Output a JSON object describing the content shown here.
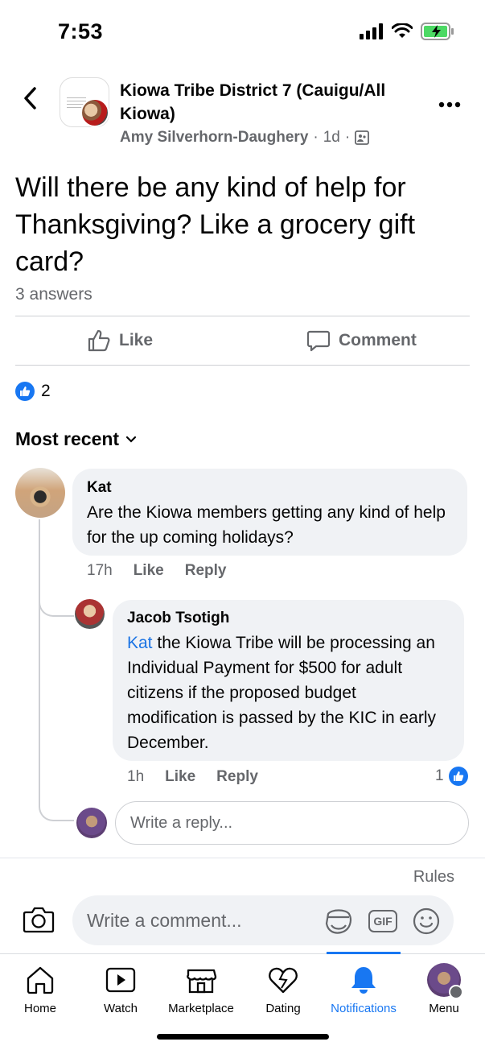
{
  "status_bar": {
    "time": "7:53"
  },
  "header": {
    "group_name": "Kiowa Tribe District 7 (Cauigu/All Kiowa)",
    "author": "Amy Silverhorn-Daughery",
    "time_ago": "1d",
    "dot": "·"
  },
  "post": {
    "question": "Will there be any kind of help for Thanksgiving? Like a grocery gift card?",
    "answers_count": "3 answers",
    "like_label": "Like",
    "comment_label": "Comment",
    "reaction_count": "2"
  },
  "sort": {
    "label": "Most recent"
  },
  "comments": [
    {
      "author": "Kat",
      "text": "Are the Kiowa members getting any kind of help for the up coming holidays?",
      "time": "17h",
      "like": "Like",
      "reply": "Reply"
    }
  ],
  "reply": {
    "author": "Jacob Tsotigh",
    "mention": "Kat",
    "text": " the Kiowa Tribe will be processing an Individual Payment for $500 for adult citizens if the proposed budget modification is passed by the KIC in early December.",
    "time": "1h",
    "like": "Like",
    "reply": "Reply",
    "reaction_count": "1"
  },
  "reply_input": {
    "placeholder": "Write a reply..."
  },
  "rules": "Rules",
  "comment_input": {
    "placeholder": "Write a comment...",
    "gif": "GIF"
  },
  "nav": [
    {
      "label": "Home",
      "icon": "home-icon"
    },
    {
      "label": "Watch",
      "icon": "watch-icon"
    },
    {
      "label": "Marketplace",
      "icon": "marketplace-icon"
    },
    {
      "label": "Dating",
      "icon": "dating-icon"
    },
    {
      "label": "Notifications",
      "icon": "bell-icon",
      "active": true
    },
    {
      "label": "Menu",
      "icon": "menu-avatar"
    }
  ],
  "colors": {
    "accent": "#1877f2",
    "secondary_text": "#65676b",
    "bubble": "#f0f2f5"
  }
}
